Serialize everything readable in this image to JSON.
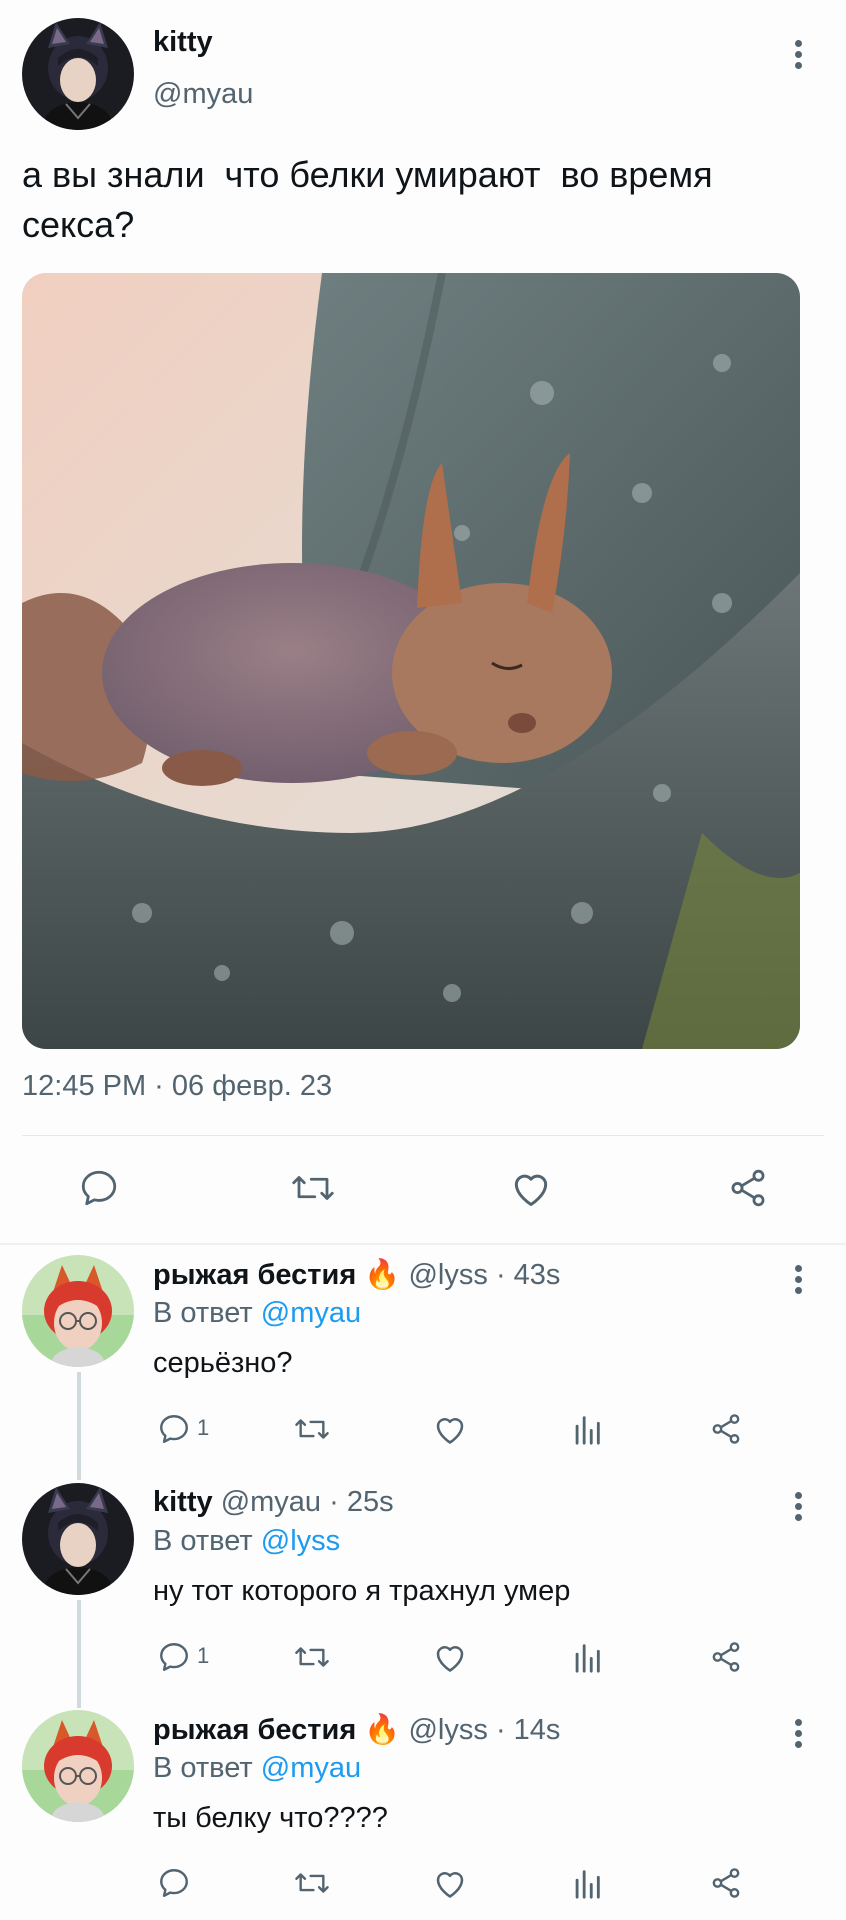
{
  "tweet": {
    "name": "kitty",
    "handle": "@myau",
    "text_line1": "а вы знали  что белки умирают  во время",
    "text_line2": "секса?",
    "timestamp": "12:45 PM · 06 февр. 23",
    "image_icon": "squirrel-photo",
    "avatar_icon": "user-avatar-dark"
  },
  "replies": [
    {
      "name": "рыжая бестия",
      "emoji": "🔥",
      "handle": "@lyss",
      "time": "· 43s",
      "reply_prefix": "В ответ",
      "reply_to": "@myau",
      "text": "серьёзно?",
      "reply_count": "1",
      "avatar_icon": "user-avatar-red"
    },
    {
      "name": "kitty",
      "emoji": "",
      "handle": "@myau",
      "time": "· 25s",
      "reply_prefix": "В ответ",
      "reply_to": "@lyss",
      "text": "ну тот которого я трахнул умер",
      "reply_count": "1",
      "avatar_icon": "user-avatar-dark"
    },
    {
      "name": "рыжая бестия",
      "emoji": "🔥",
      "handle": "@lyss",
      "time": "· 14s",
      "reply_prefix": "В ответ",
      "reply_to": "@myau",
      "text": "ты белку что????",
      "reply_count": "",
      "avatar_icon": "user-avatar-red"
    }
  ],
  "colors": {
    "accent": "#1d9bf0",
    "muted": "#536471",
    "text": "#0f1419",
    "background": "#fdfdfd"
  }
}
